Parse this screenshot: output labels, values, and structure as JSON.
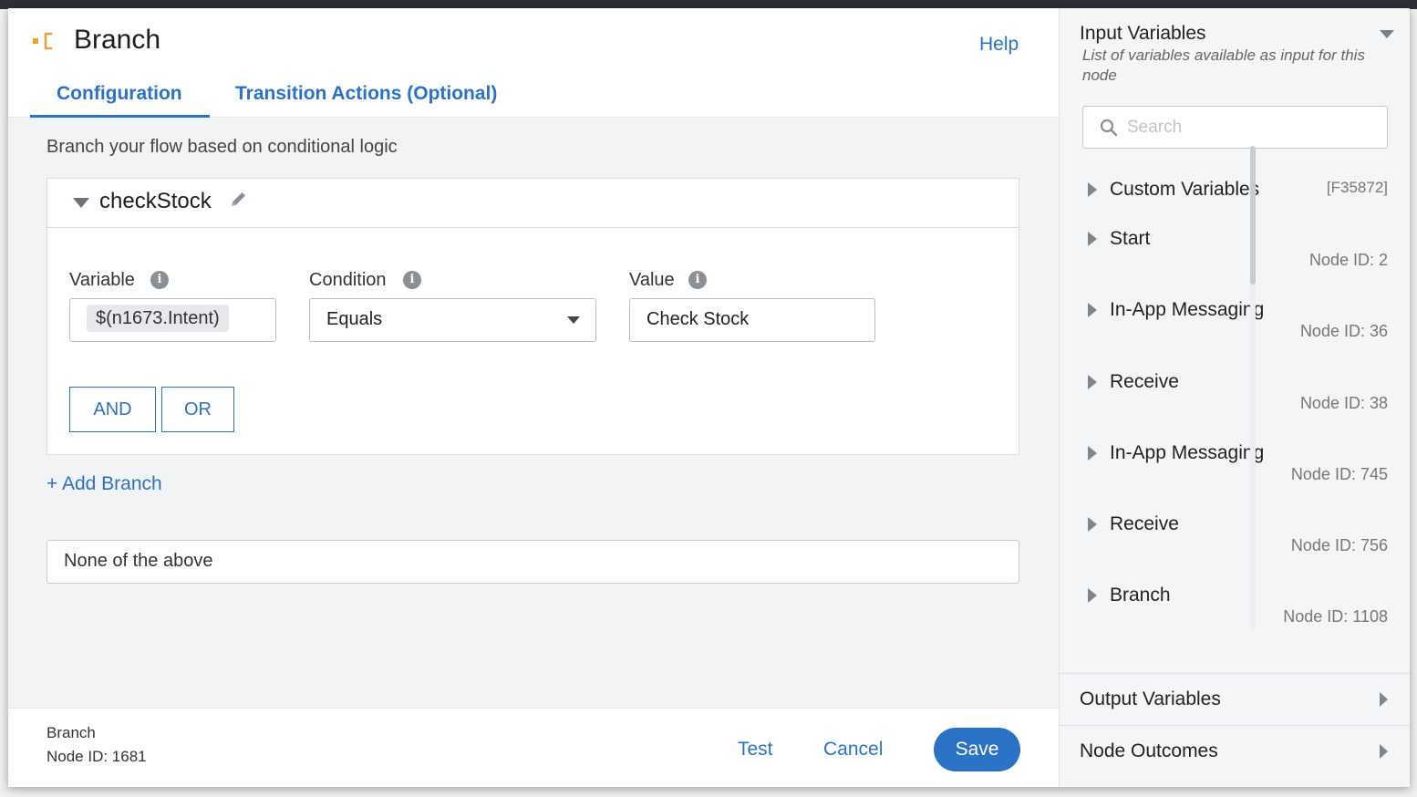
{
  "header": {
    "title": "Branch",
    "help_label": "Help",
    "tabs": [
      {
        "label": "Configuration",
        "active": true
      },
      {
        "label": "Transition Actions (Optional)",
        "active": false
      }
    ]
  },
  "main": {
    "description": "Branch your flow based on conditional logic",
    "branch": {
      "name": "checkStock",
      "variable_label": "Variable",
      "variable_value": "$(n1673.Intent)",
      "condition_label": "Condition",
      "condition_value": "Equals",
      "value_label": "Value",
      "value_value": "Check Stock",
      "and_label": "AND",
      "or_label": "OR"
    },
    "add_branch_label": "+ Add Branch",
    "default_branch_label": "None of the above"
  },
  "footer": {
    "node_name": "Branch",
    "node_id": "Node ID: 1681",
    "test_label": "Test",
    "cancel_label": "Cancel",
    "save_label": "Save"
  },
  "sidebar": {
    "input_title": "Input Variables",
    "input_description": "List of variables available as input for this node",
    "search_placeholder": "Search",
    "items": [
      {
        "label": "Custom Variables",
        "code": "[F35872]"
      },
      {
        "label": "Start",
        "node_id": "Node ID: 2"
      },
      {
        "label": "In-App Messaging",
        "node_id": "Node ID: 36"
      },
      {
        "label": "Receive",
        "node_id": "Node ID: 38"
      },
      {
        "label": "In-App Messaging",
        "node_id": "Node ID: 745"
      },
      {
        "label": "Receive",
        "node_id": "Node ID: 756"
      },
      {
        "label": "Branch",
        "node_id": "Node ID: 1108"
      }
    ],
    "output_title": "Output Variables",
    "outcomes_title": "Node Outcomes"
  },
  "colors": {
    "accent": "#2a72c6",
    "node_icon": "#f0a030"
  }
}
